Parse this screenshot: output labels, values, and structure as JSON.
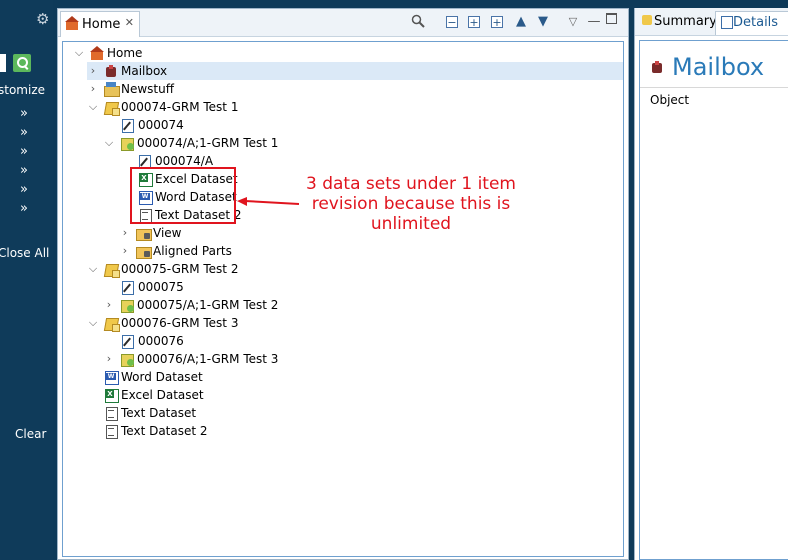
{
  "left_nav": {
    "customize_label": "stomize",
    "close_all_label": "Close All",
    "clear_label": "Clear",
    "chevron_glyph": "»"
  },
  "home_panel": {
    "tab_label": "Home",
    "tree": [
      {
        "label": "Home",
        "icon": "home-icon",
        "state": "expanded"
      },
      {
        "label": "Mailbox",
        "icon": "mailbox-icon",
        "state": "collapsed",
        "selected": true
      },
      {
        "label": "Newstuff",
        "icon": "folder-new-icon",
        "state": "collapsed"
      },
      {
        "label": "000074-GRM Test 1",
        "icon": "item-icon",
        "state": "expanded"
      },
      {
        "label": "000074",
        "icon": "form-icon"
      },
      {
        "label": "000074/A;1-GRM Test 1",
        "icon": "item-revision-icon",
        "state": "expanded"
      },
      {
        "label": "000074/A",
        "icon": "form-icon"
      },
      {
        "label": "Excel Dataset",
        "icon": "excel-icon"
      },
      {
        "label": "Word Dataset",
        "icon": "word-icon"
      },
      {
        "label": "Text Dataset 2",
        "icon": "text-icon"
      },
      {
        "label": "View",
        "icon": "folder-icon",
        "state": "collapsed"
      },
      {
        "label": "Aligned Parts",
        "icon": "folder-icon",
        "state": "collapsed"
      },
      {
        "label": "000075-GRM Test 2",
        "icon": "item-icon",
        "state": "expanded"
      },
      {
        "label": "000075",
        "icon": "form-icon"
      },
      {
        "label": "000075/A;1-GRM Test 2",
        "icon": "item-revision-icon",
        "state": "collapsed"
      },
      {
        "label": "000076-GRM Test 3",
        "icon": "item-icon",
        "state": "expanded"
      },
      {
        "label": "000076",
        "icon": "form-icon"
      },
      {
        "label": "000076/A;1-GRM Test 3",
        "icon": "item-revision-icon",
        "state": "collapsed"
      },
      {
        "label": "Word Dataset",
        "icon": "word-icon"
      },
      {
        "label": "Excel Dataset",
        "icon": "excel-icon"
      },
      {
        "label": "Text Dataset",
        "icon": "text-icon"
      },
      {
        "label": "Text Dataset 2",
        "icon": "text-icon"
      }
    ],
    "annotation": "3 data sets under 1 item revision because this is unlimited",
    "annotation_color": "#e0141e"
  },
  "right_panel": {
    "tabs": [
      {
        "label": "Summary",
        "icon": "summary-icon"
      },
      {
        "label": "Details",
        "icon": "details-icon",
        "active": true
      }
    ],
    "title": "Mailbox",
    "object_label": "Object"
  },
  "colors": {
    "nav_background": "#0f3b5a",
    "selection": "#dbe9f7",
    "accent": "#2a7ab8"
  }
}
